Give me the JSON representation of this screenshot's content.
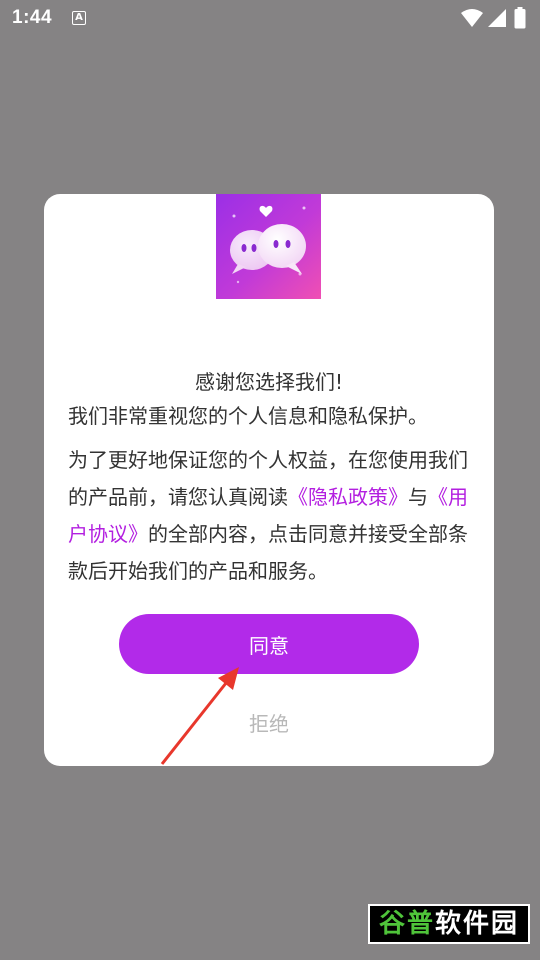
{
  "status_bar": {
    "time": "1:44",
    "notification_icon_letter": "A",
    "icons": [
      "wifi-icon",
      "signal-icon",
      "battery-icon"
    ]
  },
  "dialog": {
    "logo_icon": "chat-bubbles-logo",
    "title": "感谢您选择我们!",
    "paragraph1": "我们非常重视您的个人信息和隐私保护。",
    "paragraph2_prefix": "为了更好地保证您的个人权益，在您使用我们的产品前，请您认真阅读",
    "privacy_link": "《隐私政策》",
    "and_text": "与",
    "agreement_link": "《用户协议》",
    "paragraph2_suffix": "的全部内容，点击同意并接受全部条款后开始我们的产品和服务。",
    "agree_label": "同意",
    "reject_label": "拒绝"
  },
  "watermark": {
    "part1": "谷普",
    "part2": "软件园"
  },
  "colors": {
    "overlay": "#858384",
    "accent": "#b22ae9",
    "link": "#b31fe0",
    "arrow": "#e8372c"
  }
}
